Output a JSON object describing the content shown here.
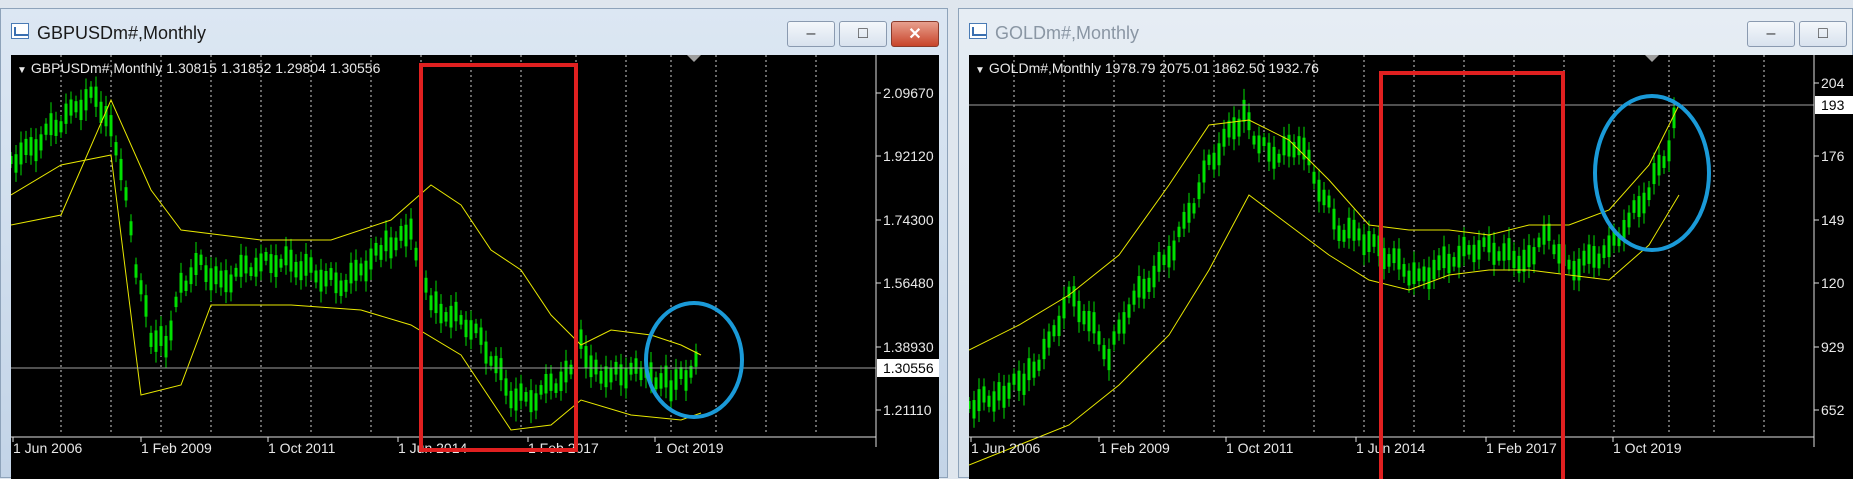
{
  "windows": [
    {
      "title": "GBPUSDm#,Monthly",
      "info": "GBPUSDm#,Monthly  1.30815 1.31852 1.29804 1.30556",
      "price_labels": [
        "2.09670",
        "1.92120",
        "1.74300",
        "1.56480",
        "1.38930",
        "1.21110"
      ],
      "current_price": "1.30556",
      "date_labels": [
        "1 Jun 2006",
        "1 Feb 2009",
        "1 Oct 2011",
        "1 Jun 2014",
        "1 Feb 2017",
        "1 Oct 2019"
      ],
      "active": true
    },
    {
      "title": "GOLDm#,Monthly",
      "info": "GOLDm#,Monthly  1978.79 2075.01 1862.50 1932.76",
      "price_labels": [
        "204",
        "176",
        "149",
        "120",
        "929",
        "652"
      ],
      "current_price": "193",
      "date_labels": [
        "1 Jun 2006",
        "1 Feb 2009",
        "1 Oct 2011",
        "1 Jun 2014",
        "1 Feb 2017",
        "1 Oct 2019"
      ],
      "active": false
    }
  ],
  "colors": {
    "candles": "#00e000",
    "bands": "#e8e800",
    "grid": "#d0d0d0",
    "highlight_rect": "#e02020",
    "highlight_ellipse": "#1a9ad8"
  },
  "buttons": {
    "minimize": "–",
    "maximize": "□",
    "close": "✕"
  }
}
